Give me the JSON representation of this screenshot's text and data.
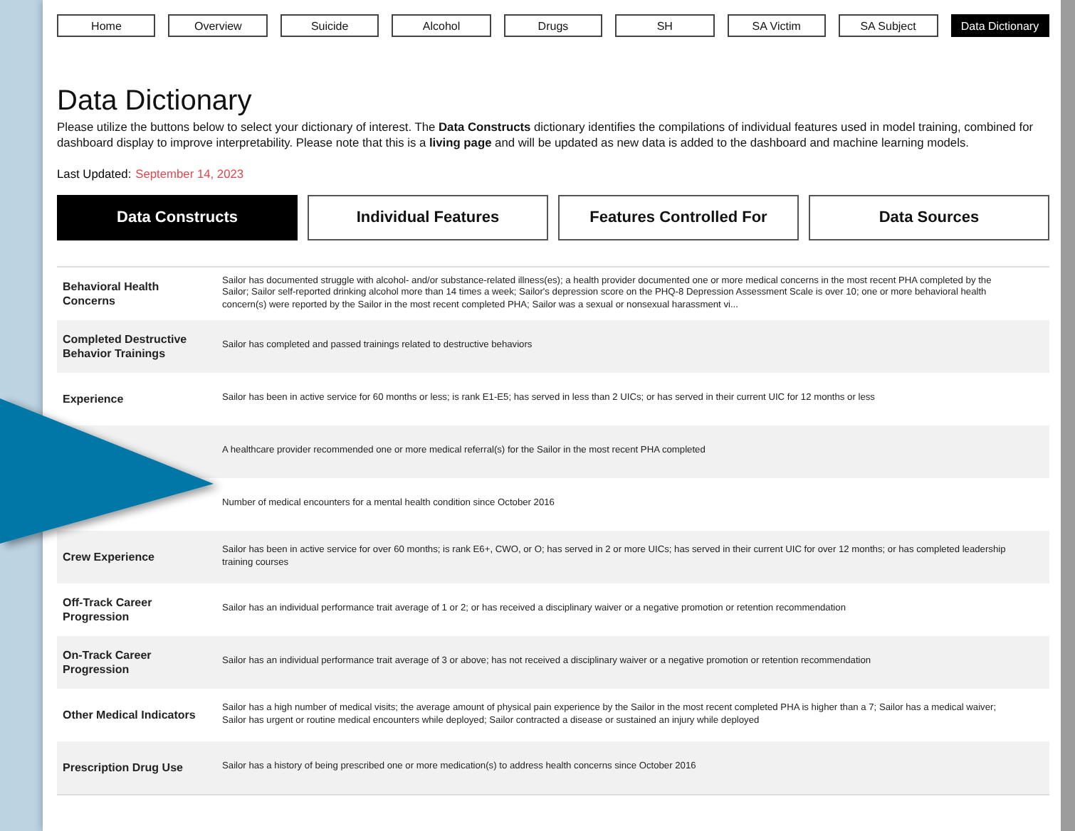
{
  "nav": [
    {
      "label": "Home",
      "selected": false
    },
    {
      "label": "Overview",
      "selected": false
    },
    {
      "label": "Suicide",
      "selected": false
    },
    {
      "label": "Alcohol",
      "selected": false
    },
    {
      "label": "Drugs",
      "selected": false
    },
    {
      "label": "SH",
      "selected": false
    },
    {
      "label": "SA Victim",
      "selected": false
    },
    {
      "label": "SA Subject",
      "selected": false
    },
    {
      "label": "Data Dictionary",
      "selected": true
    }
  ],
  "title": "Data Dictionary",
  "intro": "Please utilize the buttons below to select your dictionary of interest. The **Data Constructs** dictionary identifies the compilations of individual features used in model training, combined for dashboard display to improve interpretability. Please note that this is a **living page** and will be updated as new data is added to the dashboard and machine learning models.",
  "last_updated": {
    "label": "Last Updated:",
    "date": "September 14, 2023"
  },
  "dictionaries": [
    {
      "label": "Data Constructs",
      "selected": true
    },
    {
      "label": "Individual Features",
      "selected": false
    },
    {
      "label": "Features Controlled For",
      "selected": false
    },
    {
      "label": "Data Sources",
      "selected": false
    }
  ],
  "rows": [
    {
      "term": "Behavioral Health Concerns",
      "definition": "Sailor has documented struggle with alcohol- and/or substance-related illness(es); a health provider documented one or more medical concerns in the most recent PHA completed by the Sailor; Sailor self-reported drinking alcohol more than 14 times a week; Sailor's depression score on the PHQ-8 Depression Assessment Scale is over 10; one or more behavioral health concern(s) were reported by the Sailor in the most recent completed PHA; Sailor was a sexual or nonsexual harassment vi..."
    },
    {
      "term": "Completed Destructive Behavior Trainings",
      "definition": "Sailor has completed and passed trainings related to destructive behaviors"
    },
    {
      "term": "Experience",
      "definition": "Sailor has been in active service for 60 months or less; is rank E1-E5; has served in less than 2 UICs; or has served in their current UIC for 12 months or less"
    },
    {
      "definition": "A healthcare provider recommended one or more medical referral(s) for the Sailor in the most recent PHA completed"
    },
    {
      "definition": "Number of medical encounters for a mental health condition since October 2016"
    },
    {
      "term": "Crew Experience",
      "definition": "Sailor has been in active service for over 60 months; is rank E6+, CWO, or O; has served in 2 or more UICs; has served in their current UIC for over 12 months; or has completed leadership training courses"
    },
    {
      "term": "Off-Track Career Progression",
      "definition": "Sailor has an individual performance trait average of 1 or 2; or has received  a disciplinary waiver or a negative promotion or retention recommendation"
    },
    {
      "term": "On-Track Career Progression",
      "definition": "Sailor has an individual performance trait average of 3 or above; has not received  a disciplinary waiver or a negative promotion or retention recommendation"
    },
    {
      "term": "Other Medical Indicators",
      "definition": "Sailor has a high number of medical visits; the average amount of physical pain experience by the Sailor in the most recent completed PHA is higher than a 7; Sailor has a medical waiver; Sailor has urgent or routine medical encounters while deployed; Sailor contracted a disease or sustained an injury while deployed"
    },
    {
      "term": "Prescription Drug Use",
      "definition": "Sailor has a history of being prescribed one or more medication(s) to address health concerns since October 2016"
    }
  ]
}
